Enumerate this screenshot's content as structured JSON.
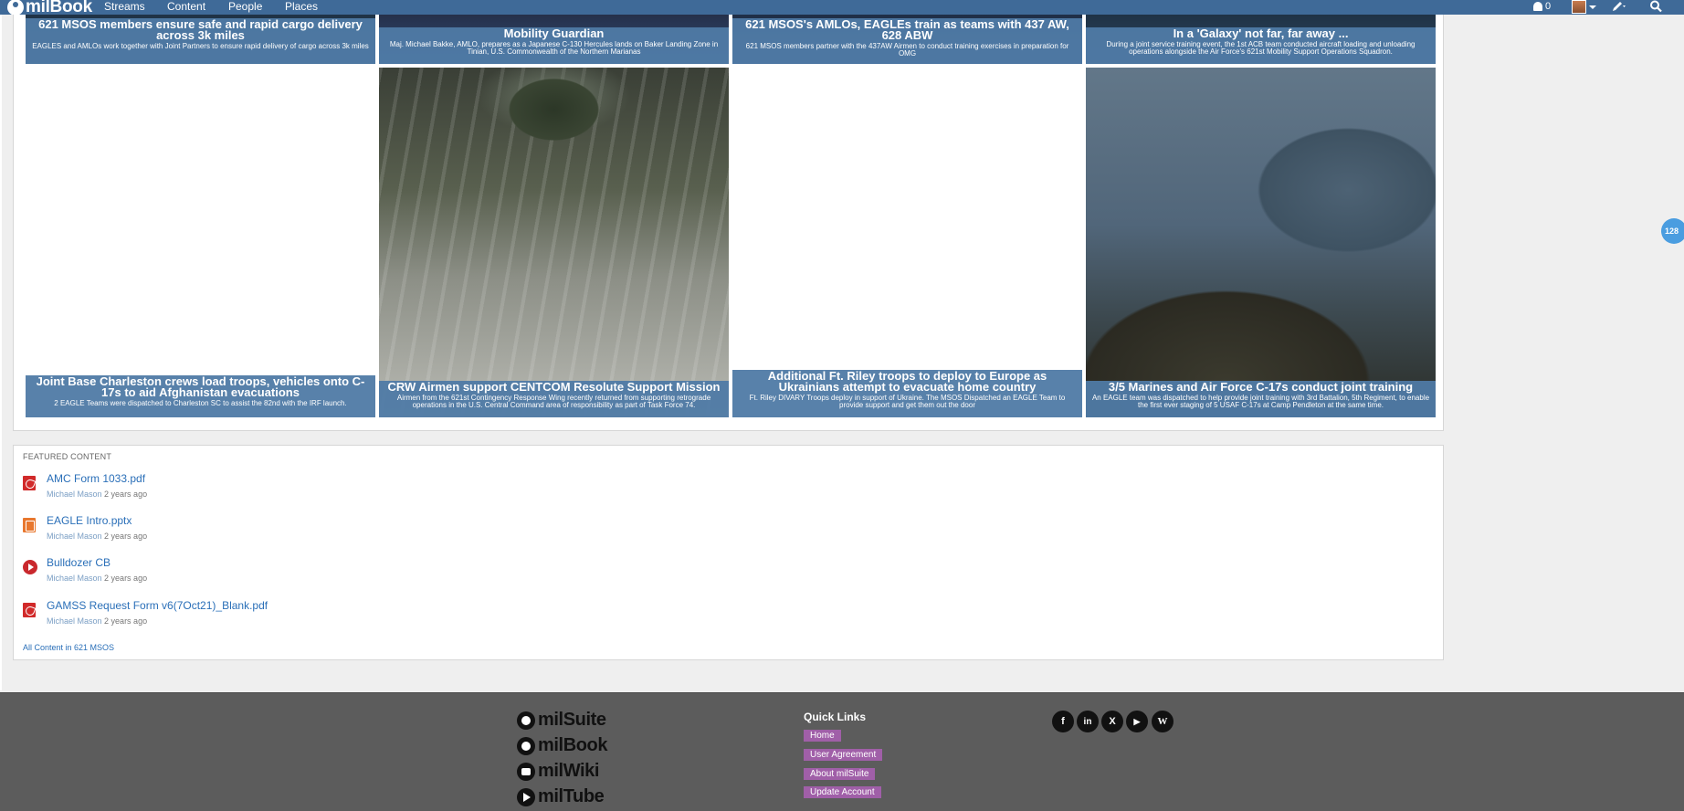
{
  "nav": {
    "brand": "milBook",
    "items": [
      {
        "label": "Streams"
      },
      {
        "label": "Content"
      },
      {
        "label": "People"
      },
      {
        "label": "Places"
      }
    ],
    "notification_count": "0"
  },
  "tiles": [
    {
      "title": "621 MSOS members ensure safe and rapid cargo delivery across 3k miles",
      "desc": "EAGLES and AMLOs work together with Joint Partners to ensure rapid delivery of cargo across 3k miles"
    },
    {
      "title": "Mobility Guardian",
      "desc": "Maj. Michael Bakke, AMLO, prepares as a Japanese C-130 Hercules lands on Baker Landing Zone in Tinian, U.S. Commonwealth of the Northern Marianas"
    },
    {
      "title": "621 MSOS's AMLOs, EAGLEs train as teams with 437 AW, 628 ABW",
      "desc": "621 MSOS members partner with the 437AW Airmen to conduct training exercises in preparation for OMG"
    },
    {
      "title": "In a 'Galaxy' not far, far away ...",
      "desc": "During a joint service training event, the 1st ACB team conducted aircraft loading and unloading operations alongside the Air Force's 621st Mobility Support Operations Squadron."
    },
    {
      "title": "Joint Base Charleston crews load troops, vehicles onto C-17s to aid Afghanistan evacuations",
      "desc": "2 EAGLE Teams were dispatched to Charleston SC to assist the 82nd with the IRF launch."
    },
    {
      "title": "CRW Airmen support CENTCOM Resolute Support Mission",
      "desc": "Airmen from the 621st Contingency Response Wing recently returned from supporting retrograde operations in the U.S. Central Command area of responsibility as part of Task Force 74."
    },
    {
      "title": "Additional Ft. Riley troops to deploy to Europe as Ukrainians attempt to evacuate home country",
      "desc": "Ft. Riley DIVARY Troops deploy in support of Ukraine. The MSOS Dispatched an EAGLE Team to provide support and get them out the door"
    },
    {
      "title": "3/5 Marines and Air Force C-17s conduct joint training",
      "desc": "An EAGLE team was dispatched to help provide joint training with 3rd Battalion, 5th Regiment, to enable the first ever staging of 5 USAF C-17s at Camp Pendleton at the same time."
    }
  ],
  "featured": {
    "label": "FEATURED CONTENT",
    "items": [
      {
        "title": "AMC Form 1033.pdf",
        "author": "Michael Mason",
        "age": "2 years ago",
        "icon": "pdf-icon"
      },
      {
        "title": "EAGLE Intro.pptx",
        "author": "Michael Mason",
        "age": "2 years ago",
        "icon": "pptx-icon"
      },
      {
        "title": "Bulldozer CB",
        "author": "Michael Mason",
        "age": "2 years ago",
        "icon": "video-play-icon"
      },
      {
        "title": "GAMSS Request Form v6(7Oct21)_Blank.pdf",
        "author": "Michael Mason",
        "age": "2 years ago",
        "icon": "pdf-icon"
      }
    ],
    "all_link": "All Content in 621 MSOS"
  },
  "side_pill": "128",
  "footer": {
    "brands": [
      "milSuite",
      "milBook",
      "milWiki",
      "milTube"
    ],
    "quick_links_title": "Quick Links",
    "quick_links": [
      "Home",
      "User Agreement",
      "About milSuite",
      "Update Account"
    ],
    "social": [
      {
        "icon": "facebook-icon",
        "glyph": "f"
      },
      {
        "icon": "linkedin-icon",
        "glyph": "in"
      },
      {
        "icon": "x-twitter-icon",
        "glyph": "X"
      },
      {
        "icon": "youtube-icon",
        "glyph": "▶"
      },
      {
        "icon": "wikipedia-icon",
        "glyph": "W"
      }
    ]
  },
  "colors": {
    "nav_bg": "#3f6a98",
    "caption_bg": "#4f7aa5",
    "link": "#2a6fb8",
    "quick_link_bg": "#a05fa8",
    "footer_bg": "#5c5c5c"
  }
}
